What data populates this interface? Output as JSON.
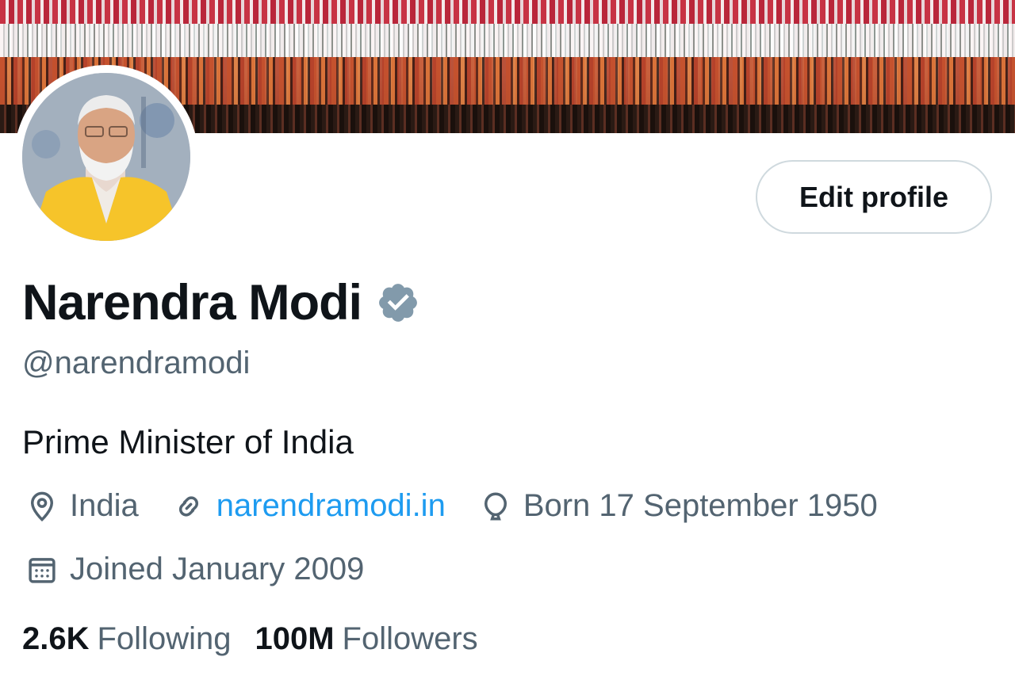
{
  "profile": {
    "name": "Narendra Modi",
    "handle": "@narendramodi",
    "bio": "Prime Minister of India",
    "location": "India",
    "website": "narendramodi.in",
    "born": "Born 17 September 1950",
    "joined": "Joined January 2009",
    "verified": true
  },
  "actions": {
    "edit_profile_label": "Edit profile"
  },
  "stats": {
    "following_count": "2.6K",
    "following_label": "Following",
    "followers_count": "100M",
    "followers_label": "Followers"
  },
  "colors": {
    "text_primary": "#0f1419",
    "text_secondary": "#536471",
    "link": "#1d9bf0",
    "verified_badge": "#829aab",
    "button_border": "#cfd9de"
  },
  "icons": {
    "location": "location-pin-icon",
    "website": "link-icon",
    "born": "balloon-icon",
    "joined": "calendar-icon",
    "verified": "verified-badge-icon"
  }
}
